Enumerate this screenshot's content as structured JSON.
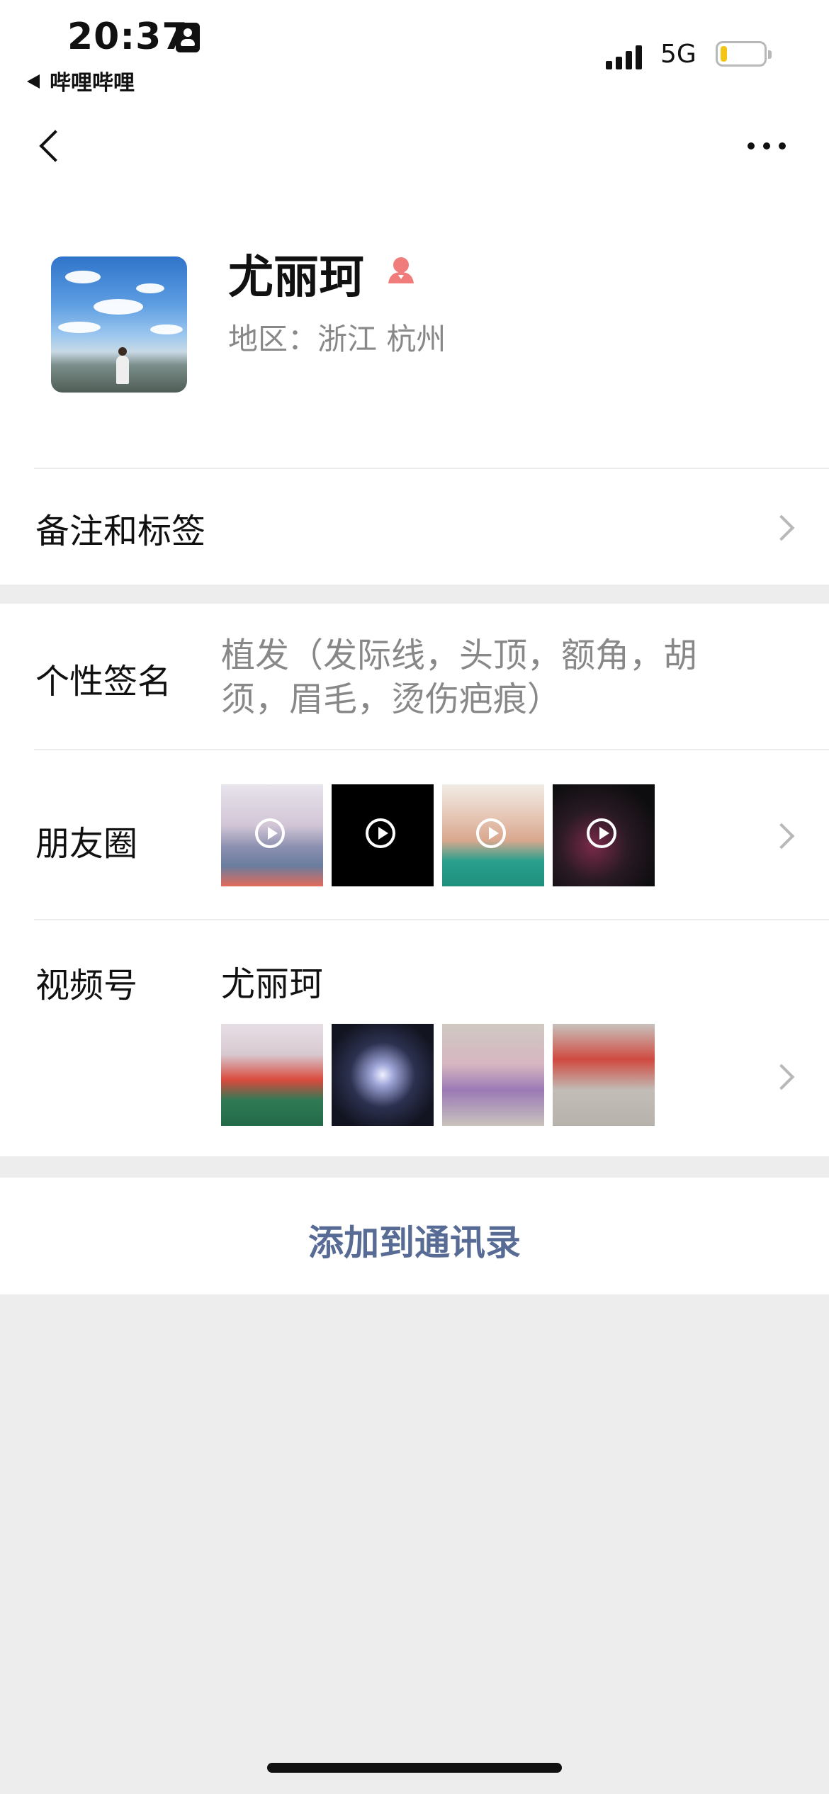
{
  "status_bar": {
    "time": "20:37",
    "back_app": "哔哩哔哩",
    "network": "5G",
    "battery_level": 0.15
  },
  "profile": {
    "name": "尤丽珂",
    "gender_icon": "female-icon",
    "region": "地区：浙江 杭州"
  },
  "rows": {
    "notes_label": "备注和标签",
    "signature_label": "个性签名",
    "signature_text": "植发（发际线，头顶，额角，胡须，眉毛，烫伤疤痕）",
    "moments_label": "朋友圈",
    "channels_label": "视频号",
    "channels_name": "尤丽珂"
  },
  "actions": {
    "add_contact": "添加到通讯录"
  },
  "colors": {
    "link": "#576b95",
    "background": "#ededed"
  }
}
